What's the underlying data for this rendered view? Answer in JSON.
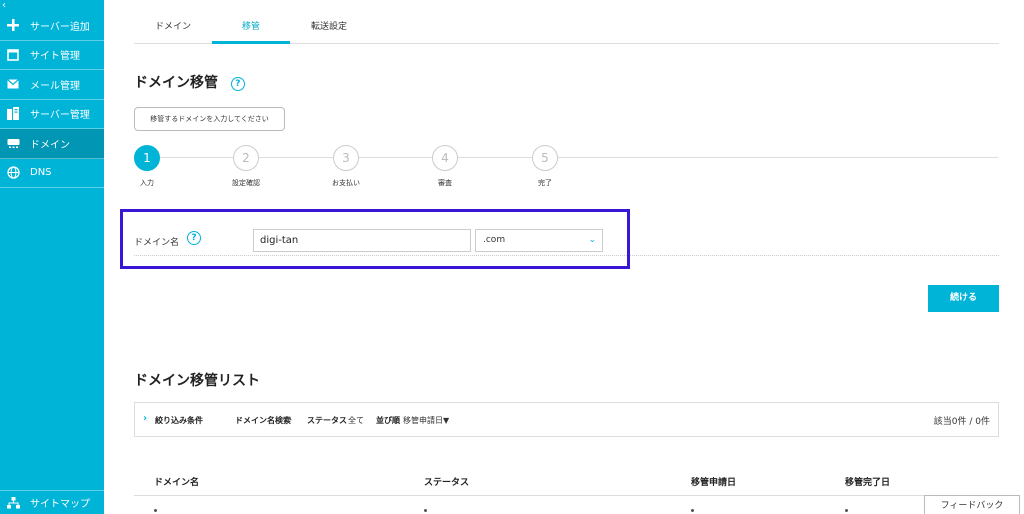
{
  "sidebar": {
    "collapse_icon": "chevron-left-icon",
    "items": [
      {
        "label": "サーバー追加",
        "icon": "plus-icon"
      },
      {
        "label": "サイト管理",
        "icon": "window-icon"
      },
      {
        "label": "メール管理",
        "icon": "envelope-icon"
      },
      {
        "label": "サーバー管理",
        "icon": "server-icon"
      },
      {
        "label": "ドメイン",
        "icon": "domain-icon",
        "active": true
      },
      {
        "label": "DNS",
        "icon": "globe-icon"
      }
    ],
    "sitemap_label": "サイトマップ"
  },
  "tabs": [
    {
      "label": "ドメイン"
    },
    {
      "label": "移管",
      "active": true
    },
    {
      "label": "転送設定"
    }
  ],
  "transfer": {
    "title": "ドメイン移管",
    "help_glyph": "?",
    "tooltip": "移管するドメインを入力してください",
    "steps": [
      {
        "number": "1",
        "label": "入力",
        "active": true
      },
      {
        "number": "2",
        "label": "設定確認"
      },
      {
        "number": "3",
        "label": "お支払い"
      },
      {
        "number": "4",
        "label": "審査"
      },
      {
        "number": "5",
        "label": "完了"
      }
    ],
    "domain_label": "ドメイン名",
    "domain_value": "digi-tan",
    "tld_value": ".com",
    "continue_label": "続ける"
  },
  "list": {
    "title": "ドメイン移管リスト",
    "filter": {
      "label": "絞り込み条件",
      "search_label": "ドメイン名検索",
      "search_value": "-",
      "status_label": "ステータス",
      "status_value": "全て",
      "sort_label": "並び順",
      "sort_value": "移管申請日▼",
      "count": "該当0件 / 0件"
    },
    "columns": [
      "ドメイン名",
      "ステータス",
      "移管申請日",
      "移管完了日"
    ]
  },
  "feedback_label": "フィードバック",
  "colors": {
    "accent": "#00b4d8",
    "sidebar_active": "#0096b4",
    "highlight": "#3a17d4"
  }
}
